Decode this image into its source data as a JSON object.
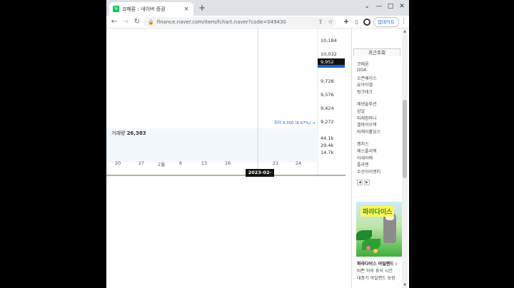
{
  "browser": {
    "tab_title": "코메론 : 네이버 증권",
    "favicon": "N",
    "url": "finance.naver.com/item/fchart.naver?code=049430",
    "update_label": "업데이트",
    "new_tab_symbol": "+",
    "close_symbol": "×"
  },
  "chart": {
    "price_labels": [
      "10,184",
      "10,032",
      "9,728",
      "9,576",
      "9,424",
      "9,272"
    ],
    "current_price_label": "9,952",
    "low_label": "최저 9,300 (6.67%) →",
    "volume_title": "거래량",
    "volume_value": "26,383",
    "volume_labels": [
      "44.1k",
      "29.4k",
      "14.7k"
    ],
    "x_ticks": [
      "20",
      "27",
      "2월",
      "6",
      "13",
      "16",
      "21",
      "24"
    ],
    "cursor_date": "2023-02-17",
    "colors": {
      "up": "#e0505a",
      "down": "#3a8ee6",
      "up_vol": "#e58a92",
      "down_vol": "#7bb6ea"
    }
  },
  "chart_data": {
    "type": "candlestick",
    "ylabel": "",
    "candles_visible_approx": [
      {
        "dir": "down"
      },
      {
        "dir": "up"
      },
      {
        "dir": "up"
      },
      {
        "dir": "down"
      },
      {
        "dir": "down"
      },
      {
        "dir": "up"
      },
      {
        "dir": "down"
      },
      {
        "dir": "up"
      },
      {
        "dir": "down"
      },
      {
        "dir": "up"
      },
      {
        "dir": "down"
      },
      {
        "dir": "up"
      },
      {
        "dir": "down"
      },
      {
        "dir": "up"
      },
      {
        "dir": "down"
      },
      {
        "dir": "up"
      },
      {
        "dir": "up"
      },
      {
        "dir": "up"
      },
      {
        "dir": "up"
      },
      {
        "dir": "down"
      },
      {
        "dir": "down"
      }
    ],
    "current_price": 9952,
    "low_price": 9300,
    "volume_last": 26383,
    "volume_axis": [
      "44.1k",
      "29.4k",
      "14.7k"
    ]
  },
  "sidepanel": {
    "recent_tab": "최근조회",
    "items": [
      "코메론",
      "DGA",
      "오픈베이스",
      "유아이엘",
      "링크테크",
      "제넨솔루션",
      "삼일",
      "미래컴퍼니",
      "셀바이오텍",
      "비케이홀딩스",
      "켐지스",
      "에스폴리텍",
      "아세아텍",
      "플라젠",
      "수산아이엔티"
    ],
    "pager_prev": "◀",
    "pager_next": "▶",
    "ad_logo": "파라다이스",
    "ad_title": "파라다이스 아일랜드 :",
    "ad_line2": "바쁜 하루 휴식 시간",
    "ad_line3": "대중가 아일랜드 농장"
  }
}
